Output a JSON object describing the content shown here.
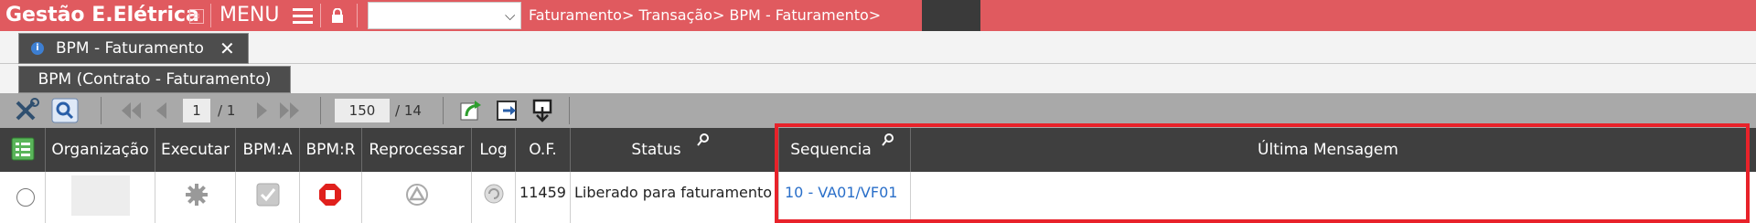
{
  "app": {
    "title": "Gestão E.Elétrica",
    "menu_label": "MENU"
  },
  "header": {
    "breadcrumb": "Faturamento> Transação> BPM - Faturamento>",
    "select_value": ""
  },
  "tabs": {
    "main_tab": "BPM - Faturamento",
    "close_symbol": "✕",
    "sub_tab": "BPM (Contrato - Faturamento)"
  },
  "pagination": {
    "page_current": "1",
    "page_total": "/ 1",
    "page_size": "150",
    "records_total": "/ 14"
  },
  "columns": [
    "Organização",
    "Executar",
    "BPM:A",
    "BPM:R",
    "Reprocessar",
    "Log",
    "O.F.",
    "Status",
    "Sequencia",
    "Última Mensagem"
  ],
  "rows": [
    {
      "organizacao": "",
      "of": "11459",
      "status": "Liberado para faturamento",
      "sequencia": "10 - VA01/VF01",
      "ultima_mensagem": ""
    }
  ],
  "colors": {
    "top_bar": "#e05a5f",
    "header_dark": "#3f3f3f",
    "toolbar": "#a9a9a9",
    "highlight": "#e8222a",
    "link": "#2a6fc9"
  },
  "icons": [
    "close-icon",
    "menu-icon",
    "lock-icon",
    "info-icon",
    "tools-icon",
    "search-icon",
    "first-page-icon",
    "prev-page-icon",
    "next-page-icon",
    "last-page-icon",
    "refresh-icon",
    "export-icon",
    "download-icon",
    "gear-icon",
    "checkbox-icon",
    "stop-icon",
    "reprocess-icon",
    "log-icon"
  ]
}
